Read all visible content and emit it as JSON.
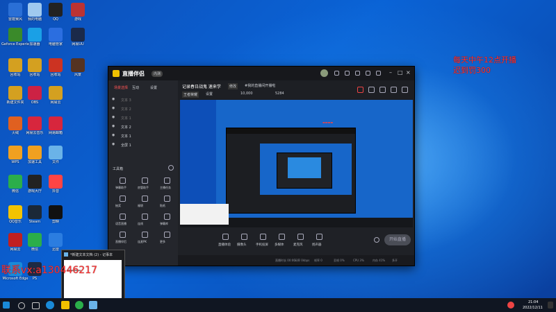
{
  "desktop_icons": [
    {
      "label": "雷霆赛风",
      "color": "#2a6fd6"
    },
    {
      "label": "我的电脑",
      "color": "#9fc9ef"
    },
    {
      "label": "QQ",
      "color": "#222"
    },
    {
      "label": "游戏",
      "color": "#b33"
    },
    {
      "label": "Geforce Experience",
      "color": "#3a8a2a"
    },
    {
      "label": "加速器",
      "color": "#1aa0e6"
    },
    {
      "label": "电脑管家",
      "color": "#2b6ee0"
    },
    {
      "label": "网易UU",
      "color": "#1b2a4a"
    },
    {
      "label": "回收站",
      "color": "#d4a020"
    },
    {
      "label": "回收站",
      "color": "#d4a020"
    },
    {
      "label": "回收站",
      "color": "#cc3322"
    },
    {
      "label": "风景",
      "color": "#553322"
    },
    {
      "label": "新建文件夹",
      "color": "#d4a020"
    },
    {
      "label": "OBS",
      "color": "#cc2244"
    },
    {
      "label": "网易云",
      "color": "#d4a020"
    },
    {
      "label": "火绒",
      "color": "#e06020"
    },
    {
      "label": "网易云音乐",
      "color": "#d7263d"
    },
    {
      "label": "网易邮箱",
      "color": "#d7263d"
    },
    {
      "label": "WPS",
      "color": "#f0a020"
    },
    {
      "label": "加速工具",
      "color": "#f0a020"
    },
    {
      "label": "文件",
      "color": "#6ab3e8"
    },
    {
      "label": "微信",
      "color": "#2bae4a"
    },
    {
      "label": "游戏大厅",
      "color": "#222"
    },
    {
      "label": "抖音",
      "color": "#f44"
    },
    {
      "label": "QQ音乐",
      "color": "#f2c300"
    },
    {
      "label": "Steam",
      "color": "#1b2838"
    },
    {
      "label": "剪映",
      "color": "#111"
    },
    {
      "label": "网易云",
      "color": "#c02020"
    },
    {
      "label": "微信",
      "color": "#2bae4a"
    },
    {
      "label": "迅雷",
      "color": "#2b7de0"
    },
    {
      "label": "Microsoft Edge",
      "color": "#1a8ad8"
    },
    {
      "label": "PS",
      "color": "#1e2a44"
    }
  ],
  "overlay": {
    "notice_line1": "每天中午12点开播",
    "notice_line2": "迟到罚300",
    "contact": "联系vx:a130446217"
  },
  "app": {
    "title": "直播伴侣",
    "badge": "内测",
    "side_tabs": [
      "场景选择",
      "互动",
      "设置"
    ],
    "scenes": [
      "文本 3",
      "文本 2",
      "文本 1",
      "文本 2",
      "文本 1",
      "全屏 1"
    ],
    "tools_header": "工具箱",
    "tools": [
      "弹幕助手",
      "房管助手",
      "主播任务",
      "抽奖",
      "福袋",
      "贴纸",
      "语音直播",
      "连线",
      "弹幕库",
      "直播伴侣",
      "连麦PK",
      "更多"
    ],
    "room": {
      "title": "记录春日战鬼 速来学",
      "edit": "修改",
      "notice": "#我的直播间开播啦",
      "category": "王者荣耀",
      "settings": "设置",
      "stats": "10,000",
      "fans": "5284"
    },
    "controls": [
      "直播体验",
      "摄像头",
      "手机投屏",
      "多媒体",
      "麦克风",
      "扬声器"
    ],
    "start_button": "开始直播",
    "status": [
      "直播时长 00:00",
      "码率 0kbps",
      "帧率 0",
      "丢帧 0%",
      "CPU 3%",
      "内存 41%",
      "多开"
    ]
  },
  "notepad": {
    "title": "*新建文本文档 (2) - 记事本"
  },
  "taskbar": {
    "time": "21:04",
    "date": "2022/12/11",
    "search_text": ""
  }
}
